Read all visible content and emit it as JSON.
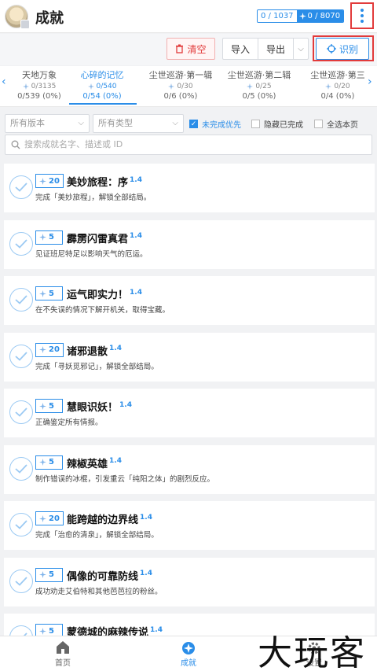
{
  "header": {
    "title": "成就",
    "stats_completed": "0 / 1037",
    "stats_gems": "0 / 8070"
  },
  "toolbar": {
    "clear_label": "清空",
    "import_label": "导入",
    "export_label": "导出",
    "recognize_label": "识别"
  },
  "tabs": [
    {
      "name": "天地万象",
      "count": "0/3135",
      "progress": "0/539 (0%)"
    },
    {
      "name": "心碎的记忆",
      "count": "0/540",
      "progress": "0/54 (0%)"
    },
    {
      "name": "尘世巡游·第一辑",
      "count": "0/30",
      "progress": "0/6 (0%)"
    },
    {
      "name": "尘世巡游·第二辑",
      "count": "0/25",
      "progress": "0/5 (0%)"
    },
    {
      "name": "尘世巡游·第三",
      "count": "0/20",
      "progress": "0/4 (0%)"
    }
  ],
  "filters": {
    "version_placeholder": "所有版本",
    "type_placeholder": "所有类型",
    "unfinished_first": "未完成优先",
    "hide_finished": "隐藏已完成",
    "select_page": "全选本页",
    "search_placeholder": "搜索成就名字、描述或 ID"
  },
  "achievements": [
    {
      "reward": "20",
      "name": "美妙旅程：序",
      "version": "1.4",
      "desc": "完成「美妙旅程」，解锁全部结局。"
    },
    {
      "reward": "5",
      "name": "霹雳闪雷真君",
      "version": "1.4",
      "desc": "见证班尼特足以影响天气的厄运。"
    },
    {
      "reward": "5",
      "name": "运气即实力！",
      "version": "1.4",
      "desc": "在不失误的情况下解开机关，取得宝藏。"
    },
    {
      "reward": "20",
      "name": "诸邪退散",
      "version": "1.4",
      "desc": "完成「寻妖觅邪记」，解锁全部结局。"
    },
    {
      "reward": "5",
      "name": "慧眼识妖！",
      "version": "1.4",
      "desc": "正确鉴定所有情报。"
    },
    {
      "reward": "5",
      "name": "辣椒英雄",
      "version": "1.4",
      "desc": "制作错误的冰棍，引发重云「纯阳之体」的剧烈反应。"
    },
    {
      "reward": "20",
      "name": "能跨越的边界线",
      "version": "1.4",
      "desc": "完成「治愈的清泉」，解锁全部结局。"
    },
    {
      "reward": "5",
      "name": "偶像的可靠防线",
      "version": "1.4",
      "desc": "成功劝走艾伯特和其他芭芭拉的粉丝。"
    },
    {
      "reward": "5",
      "name": "蒙德城的麻辣传说",
      "version": "1.4",
      "desc": ""
    }
  ],
  "bottom_nav": {
    "home": "首页",
    "achievements": "成就",
    "settings": "设置"
  },
  "watermark": "大玩客"
}
